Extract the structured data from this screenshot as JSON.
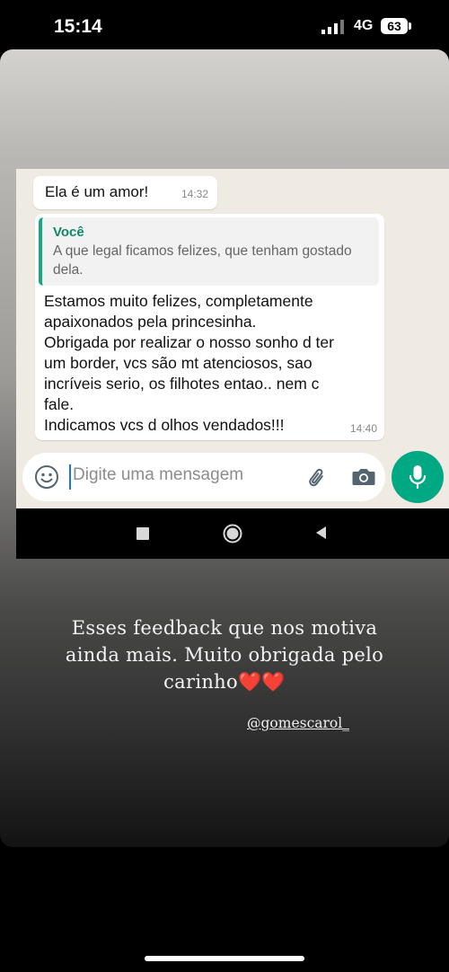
{
  "status_bar": {
    "time": "15:14",
    "network": "4G",
    "battery": "63",
    "signal_strength": "3 of 4 bars"
  },
  "chat": {
    "messages": [
      {
        "text": "Ela é um amor!",
        "time": "14:32"
      },
      {
        "quote": {
          "author": "Você",
          "text": "A que legal ficamos felizes, que tenham gostado dela."
        },
        "lines": [
          "Estamos muito felizes, completamente",
          "apaixonados pela princesinha.",
          "Obrigada por realizar o nosso sonho d ter",
          "um border, vcs são mt atenciosos, sao",
          "incríveis serio, os filhotes entao.. nem c",
          "fale.",
          "Indicamos vcs d olhos vendados!!!"
        ],
        "time": "14:40"
      }
    ],
    "input": {
      "placeholder": "Digite uma mensagem",
      "value": ""
    },
    "colors": {
      "accent": "#00a884",
      "chat_background": "#efeae2",
      "quote_bar": "#1aa680"
    }
  },
  "caption": {
    "lines": [
      "Esses feedback que nos motiva",
      "ainda mais. Muito obrigada pelo",
      "carinho"
    ],
    "hearts": "❤️❤️",
    "mention": "@gomescarol_"
  }
}
